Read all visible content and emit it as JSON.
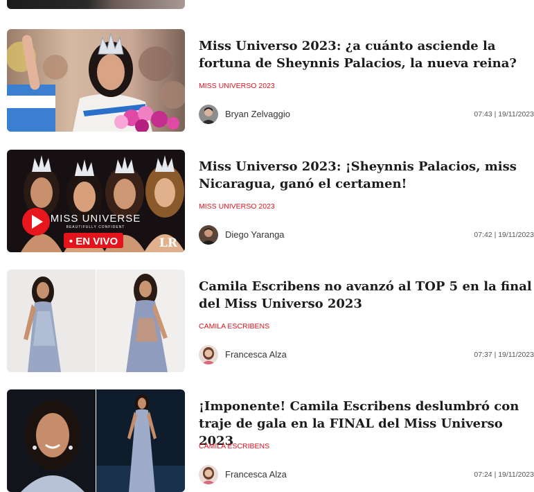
{
  "articles": [
    {
      "title": "Miss Universo 2023: ¿a cuánto asciende la fortuna de Sheynnis Palacios, la nueva reina?",
      "category": "MISS UNIVERSO 2023",
      "author": "Bryan Zelvaggio",
      "timestamp": "07:43 | 19/11/2023"
    },
    {
      "title": "Miss Universo 2023: ¡Sheynnis Palacios, miss Nicaragua, ganó el certamen!",
      "category": "MISS UNIVERSO 2023",
      "author": "Diego Yaranga",
      "timestamp": "07:42 | 19/11/2023",
      "thumb_overlay": {
        "brand": "MISS UNIVERSE",
        "tagline": "BEAUTIFULLY CONFIDENT",
        "live_badge": "• EN VIVO",
        "logo": "LR"
      }
    },
    {
      "title": "Camila Escribens no avanzó al TOP 5 en la final del Miss Universo 2023",
      "category": "CAMILA ESCRIBENS",
      "author": "Francesca Alza",
      "timestamp": "07:37 | 19/11/2023"
    },
    {
      "title": "¡Imponente! Camila Escribens deslumbró con traje de gala en la FINAL del Miss Universo 2023",
      "category": "CAMILA ESCRIBENS",
      "author": "Francesca Alza",
      "timestamp": "07:24 | 19/11/2023"
    }
  ],
  "colors": {
    "category": "#e0131f",
    "title": "#1c1c1c",
    "live_badge": "#e3141b"
  }
}
